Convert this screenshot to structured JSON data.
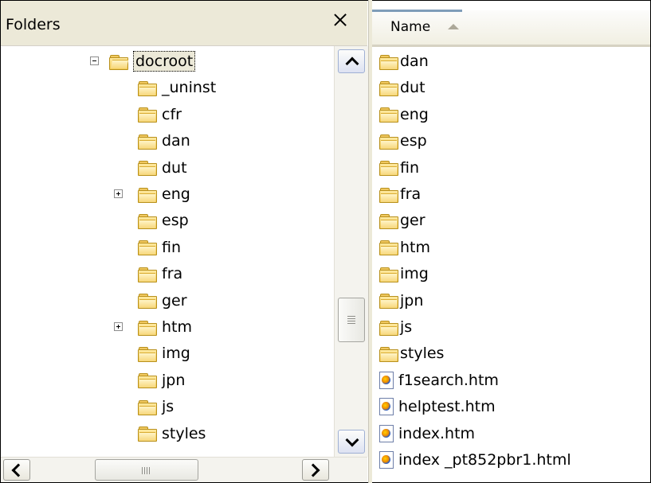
{
  "folders_pane": {
    "title": "Folders",
    "tree": [
      {
        "label": "docroot",
        "expander": "minus",
        "selected": true,
        "open": true,
        "level": 0
      },
      {
        "label": "_uninst",
        "level": 1
      },
      {
        "label": "cfr",
        "level": 1
      },
      {
        "label": "dan",
        "level": 1
      },
      {
        "label": "dut",
        "level": 1
      },
      {
        "label": "eng",
        "expander": "plus",
        "level": 1
      },
      {
        "label": "esp",
        "level": 1
      },
      {
        "label": "fin",
        "level": 1
      },
      {
        "label": "fra",
        "level": 1
      },
      {
        "label": "ger",
        "level": 1
      },
      {
        "label": "htm",
        "expander": "plus",
        "level": 1
      },
      {
        "label": "img",
        "level": 1
      },
      {
        "label": "jpn",
        "level": 1
      },
      {
        "label": "js",
        "level": 1
      },
      {
        "label": "styles",
        "level": 1
      }
    ]
  },
  "file_list": {
    "column_header": "Name",
    "sort": "ascending",
    "items": [
      {
        "name": "dan",
        "type": "folder"
      },
      {
        "name": "dut",
        "type": "folder"
      },
      {
        "name": "eng",
        "type": "folder"
      },
      {
        "name": "esp",
        "type": "folder"
      },
      {
        "name": "fin",
        "type": "folder"
      },
      {
        "name": "fra",
        "type": "folder"
      },
      {
        "name": "ger",
        "type": "folder"
      },
      {
        "name": "htm",
        "type": "folder"
      },
      {
        "name": "img",
        "type": "folder"
      },
      {
        "name": "jpn",
        "type": "folder"
      },
      {
        "name": "js",
        "type": "folder"
      },
      {
        "name": "styles",
        "type": "folder"
      },
      {
        "name": "f1search.htm",
        "type": "html"
      },
      {
        "name": "helptest.htm",
        "type": "html"
      },
      {
        "name": "index.htm",
        "type": "html"
      },
      {
        "name": "index _pt852pbr1.html",
        "type": "html"
      }
    ]
  },
  "icons": {
    "folder": "folder-icon",
    "html_file": "html-file-icon",
    "close": "close-icon"
  }
}
